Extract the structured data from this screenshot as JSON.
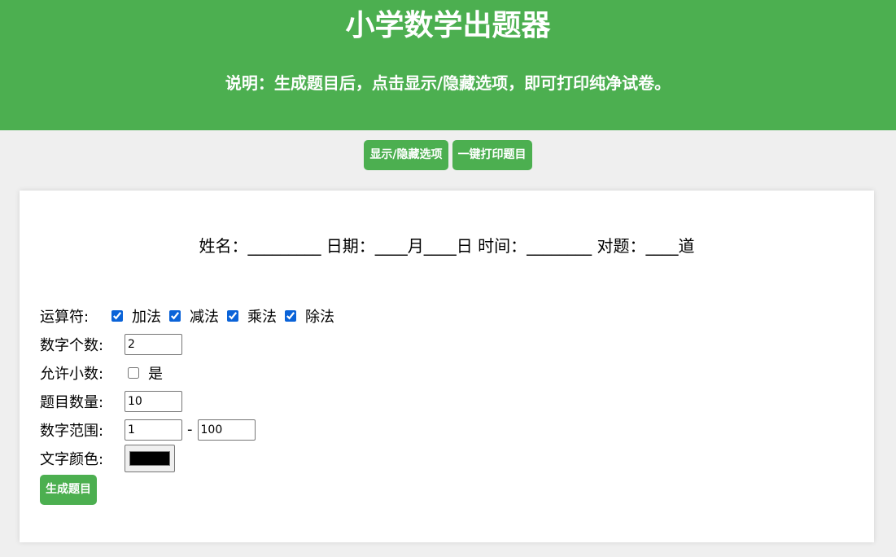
{
  "header": {
    "title": "小学数学出题器",
    "subtitle": "说明：生成题目后，点击显示/隐藏选项，即可打印纯净试卷。"
  },
  "toolbar": {
    "toggle_label": "显示/隐藏选项",
    "print_label": "一键打印题目"
  },
  "info_line": "姓名：_________ 日期：____月____日 时间：________ 对题：____道",
  "options": {
    "operators_label": "运算符:",
    "operators": [
      {
        "label": "加法",
        "checked": true
      },
      {
        "label": "减法",
        "checked": true
      },
      {
        "label": "乘法",
        "checked": true
      },
      {
        "label": "除法",
        "checked": true
      }
    ],
    "count_label": "数字个数:",
    "count_value": "2",
    "decimal_label": "允许小数:",
    "decimal_option": "是",
    "decimal_checked": false,
    "questions_label": "题目数量:",
    "questions_value": "10",
    "range_label": "数字范围:",
    "range_min": "1",
    "range_sep": "-",
    "range_max": "100",
    "color_label": "文字颜色:",
    "color_value": "#000000",
    "generate_label": "生成题目"
  },
  "colors": {
    "accent": "#4caf50",
    "background": "#efefef",
    "card": "#ffffff"
  }
}
